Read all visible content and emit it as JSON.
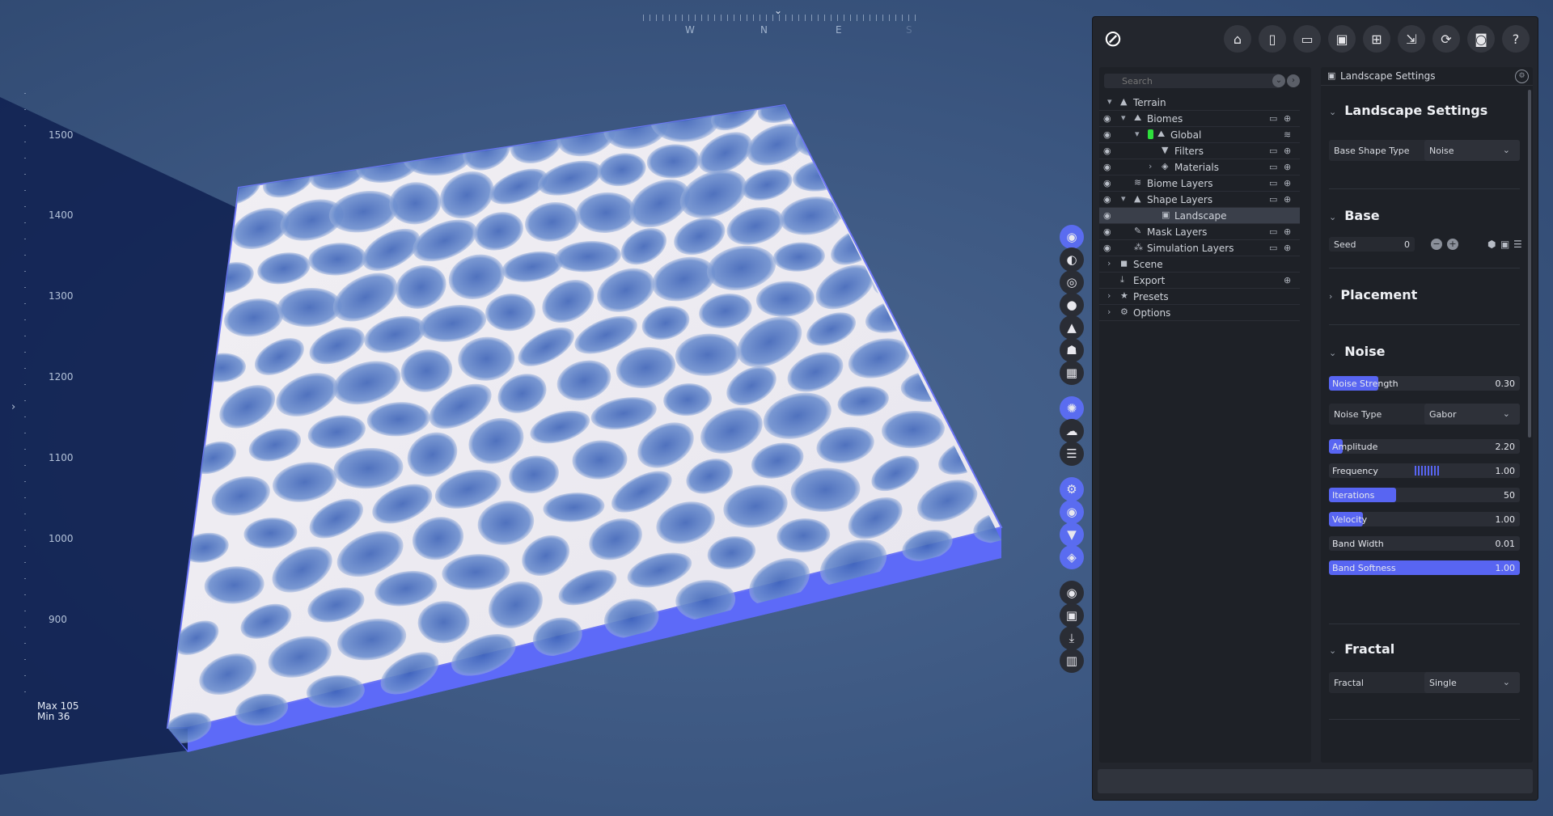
{
  "compass": {
    "labels": [
      "W",
      "N",
      "E",
      "S"
    ]
  },
  "ruler": {
    "labels": [
      "1500",
      "1400",
      "1300",
      "1200",
      "1100",
      "1000",
      "900"
    ]
  },
  "minmax": {
    "max": "Max 105",
    "min": "Min 36"
  },
  "colors": {
    "accent": "#5865f2",
    "panel": "#23262d",
    "viewport": "#3b5680",
    "terrain_side": "#5d6af8"
  },
  "tools": [
    {
      "icon": "landscape-icon",
      "glyph": "◉",
      "active": true
    },
    {
      "icon": "globe-icon",
      "glyph": "◐",
      "active": false
    },
    {
      "icon": "biome-icon",
      "glyph": "◎",
      "active": false
    },
    {
      "icon": "water-drop-icon",
      "glyph": "●",
      "active": false
    },
    {
      "icon": "mountain-icon",
      "glyph": "▲",
      "active": false
    },
    {
      "icon": "mask-icon",
      "glyph": "☗",
      "active": false
    },
    {
      "icon": "grid-icon",
      "glyph": "▦",
      "active": false
    },
    {
      "icon": "sun-icon",
      "glyph": "✺",
      "active": true
    },
    {
      "icon": "cloud-icon",
      "glyph": "☁",
      "active": false
    },
    {
      "icon": "fog-icon",
      "glyph": "☰",
      "active": false
    },
    {
      "icon": "gears-icon",
      "glyph": "⚙",
      "active": true
    },
    {
      "icon": "eye-icon",
      "glyph": "◉",
      "active": true
    },
    {
      "icon": "filter-icon",
      "glyph": "▼",
      "active": true
    },
    {
      "icon": "layers-icon",
      "glyph": "◈",
      "active": true
    },
    {
      "icon": "record-icon",
      "glyph": "◉",
      "active": false
    },
    {
      "icon": "image-icon",
      "glyph": "▣",
      "active": false
    },
    {
      "icon": "download-icon",
      "glyph": "⤓",
      "active": false
    },
    {
      "icon": "chart-icon",
      "glyph": "▥",
      "active": false
    }
  ],
  "toolbar": [
    {
      "icon": "home-icon",
      "glyph": "⌂"
    },
    {
      "icon": "new-file-icon",
      "glyph": "▯"
    },
    {
      "icon": "open-folder-icon",
      "glyph": "▭"
    },
    {
      "icon": "save-icon",
      "glyph": "▣"
    },
    {
      "icon": "save-as-icon",
      "glyph": "⊞"
    },
    {
      "icon": "export-file-icon",
      "glyph": "⇲"
    },
    {
      "icon": "refresh-icon",
      "glyph": "⟳"
    },
    {
      "icon": "camera-icon",
      "glyph": "◙"
    },
    {
      "icon": "help-icon",
      "glyph": "?"
    }
  ],
  "tree": {
    "search_placeholder": "Search",
    "rows": [
      {
        "label": "Terrain",
        "indent": 0,
        "eye": false,
        "chev": "▾",
        "icon": "▲",
        "icon_name": "terrain-icon",
        "r1": "",
        "r2": ""
      },
      {
        "label": "Biomes",
        "indent": 1,
        "eye": true,
        "chev": "▾",
        "icon": "⛰",
        "icon_name": "biomes-icon",
        "r1": "▭",
        "r2": "⊕"
      },
      {
        "label": "Global",
        "indent": 2,
        "eye": true,
        "chev": "▾",
        "icon": "⛰",
        "icon_name": "global-biome-icon",
        "green": true,
        "r1": "",
        "r2": "≋"
      },
      {
        "label": "Filters",
        "indent": 3,
        "eye": true,
        "chev": "",
        "icon": "▼",
        "icon_name": "filter-icon",
        "r1": "▭",
        "r2": "⊕"
      },
      {
        "label": "Materials",
        "indent": 3,
        "eye": true,
        "chev": "›",
        "icon": "◈",
        "icon_name": "materials-icon",
        "r1": "▭",
        "r2": "⊕"
      },
      {
        "label": "Biome Layers",
        "indent": 1,
        "eye": true,
        "chev": "",
        "icon": "≋",
        "icon_name": "biome-layers-icon",
        "r1": "▭",
        "r2": "⊕"
      },
      {
        "label": "Shape Layers",
        "indent": 1,
        "eye": true,
        "chev": "▾",
        "icon": "▲",
        "icon_name": "shape-layers-icon",
        "r1": "▭",
        "r2": "⊕"
      },
      {
        "label": "Landscape",
        "indent": 3,
        "eye": true,
        "chev": "",
        "icon": "▣",
        "icon_name": "landscape-icon",
        "selected": true,
        "r1": "",
        "r2": ""
      },
      {
        "label": "Mask Layers",
        "indent": 1,
        "eye": true,
        "chev": "",
        "icon": "✎",
        "icon_name": "mask-layers-icon",
        "r1": "▭",
        "r2": "⊕"
      },
      {
        "label": "Simulation Layers",
        "indent": 1,
        "eye": true,
        "chev": "",
        "icon": "⁂",
        "icon_name": "simulation-layers-icon",
        "r1": "▭",
        "r2": "⊕"
      },
      {
        "label": "Scene",
        "indent": 0,
        "eye": false,
        "chev": "›",
        "icon": "◼",
        "icon_name": "scene-icon",
        "r1": "",
        "r2": ""
      },
      {
        "label": "Export",
        "indent": 0,
        "eye": false,
        "chev": "",
        "icon": "⤓",
        "icon_name": "export-icon",
        "r1": "",
        "r2": "⊕"
      },
      {
        "label": "Presets",
        "indent": 0,
        "eye": false,
        "chev": "›",
        "icon": "★",
        "icon_name": "presets-icon",
        "r1": "",
        "r2": ""
      },
      {
        "label": "Options",
        "indent": 0,
        "eye": false,
        "chev": "›",
        "icon": "⚙",
        "icon_name": "options-icon",
        "r1": "",
        "r2": ""
      }
    ]
  },
  "props": {
    "header": "Landscape Settings",
    "sections": {
      "landscape_settings": "Landscape Settings",
      "base": "Base",
      "placement": "Placement",
      "noise": "Noise",
      "fractal": "Fractal"
    },
    "base_shape": {
      "label": "Base Shape Type",
      "value": "Noise"
    },
    "seed": {
      "label": "Seed",
      "value": "0"
    },
    "noise_strength": {
      "label": "Noise Strength",
      "value": "0.30",
      "fill": 0.26
    },
    "noise_type": {
      "label": "Noise Type",
      "value": "Gabor"
    },
    "sliders": [
      {
        "key": "amplitude",
        "label": "Amplitude",
        "value": "2.20",
        "fill": 0.07
      },
      {
        "key": "frequency",
        "label": "Frequency",
        "value": "1.00",
        "fill": 0
      },
      {
        "key": "iterations",
        "label": "Iterations",
        "value": "50",
        "fill": 0.35
      },
      {
        "key": "velocity",
        "label": "Velocity",
        "value": "1.00",
        "fill": 0.18
      },
      {
        "key": "band-width",
        "label": "Band Width",
        "value": "0.01",
        "fill": 0
      },
      {
        "key": "band-softness",
        "label": "Band Softness",
        "value": "1.00",
        "fill": 1.0
      }
    ],
    "fractal": {
      "label": "Fractal",
      "value": "Single"
    }
  }
}
